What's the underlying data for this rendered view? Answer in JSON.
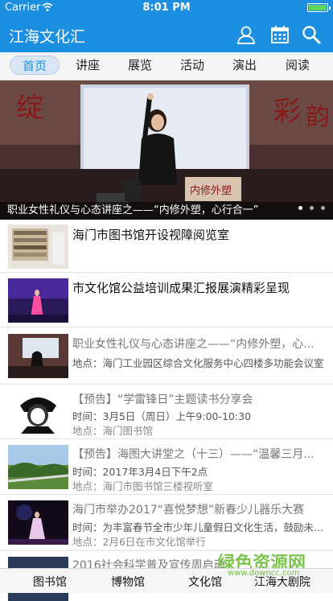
{
  "status": {
    "carrier": "Carrier",
    "time": "8:01 PM"
  },
  "app": {
    "title": "江海文化汇"
  },
  "tabs": [
    "首页",
    "讲座",
    "展览",
    "活动",
    "演出",
    "阅读"
  ],
  "banner": {
    "caption": "职业女性礼仪与心态讲座之——“内修外塑，心行合一”",
    "stage_text": "内修外塑"
  },
  "news": [
    {
      "title": "海门市图书馆开设视障阅览室"
    },
    {
      "title": "市文化馆公益培训成果汇报展演精彩呈现"
    },
    {
      "title": "职业女性礼仪与心态讲座之——“内修外塑，心...",
      "place_label": "地点：",
      "place": "海门工业园区综合文化服务中心四楼多功能会议室"
    },
    {
      "title": "【预告】“学雷锋日”主题读书分享会",
      "time_label": "时间：",
      "time": "3月5日（周日）上午9:00-10:30",
      "place_label": "地点：",
      "place": "海门图书馆"
    },
    {
      "title": "【预告】海图大讲堂之（十三）——“温馨三月...",
      "time_label": "时间：",
      "time": "2017年3月4日下午2点",
      "place_label": "地点：",
      "place": "海门市图书馆三楼视听室"
    },
    {
      "title": "海门市举办2017“喜悦梦想”新春少儿器乐大赛",
      "time_label": "时间：",
      "time": "为丰富春节全市少年儿童假日文化生活，鼓励未...",
      "place_label": "地点：",
      "place": "2月6日在市文化馆举行"
    },
    {
      "title": "2016社会科学普及宣传周启动"
    }
  ],
  "bottom_nav": [
    "图书馆",
    "博物馆",
    "文化馆",
    "江海大剧院"
  ],
  "watermark": {
    "text": "绿色资源网",
    "url": "www.downcc.com"
  },
  "colors": {
    "brand": "#1d8fe0",
    "watermark": "#6fbf3c"
  }
}
